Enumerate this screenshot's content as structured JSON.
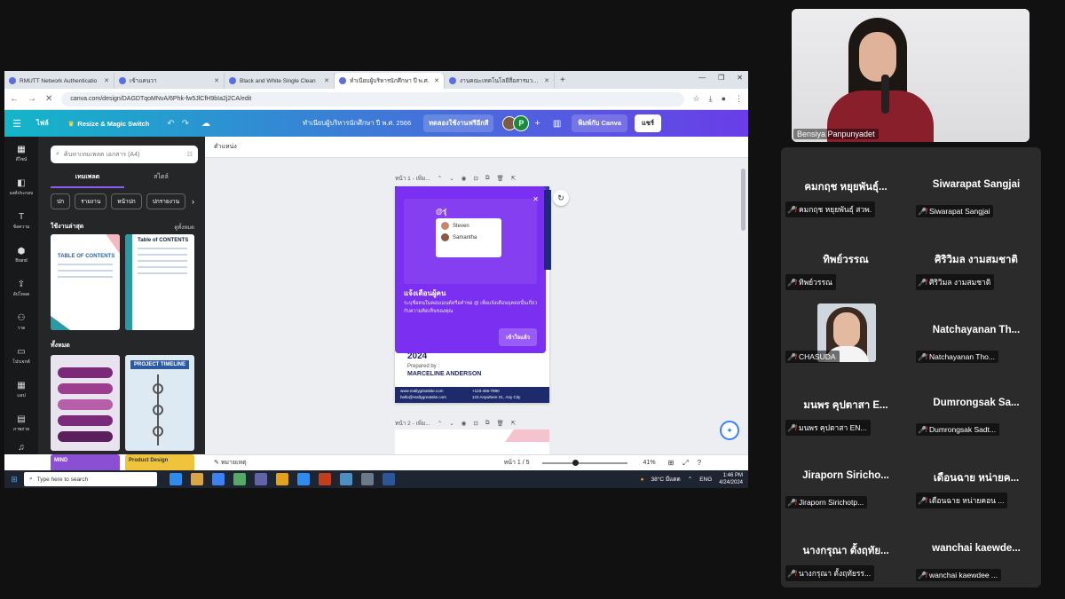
{
  "browser": {
    "tabs": [
      {
        "title": "RMUTT Network Authenticatio"
      },
      {
        "title": "เข้าแคนวา"
      },
      {
        "title": "Black and White Single Clean"
      },
      {
        "title": "ทำเนียบผู้บริหารนักศึกษา ปี พ.ศ."
      },
      {
        "title": "งานคณะเทคโนโลยีสื่อสารมวลชน - ..."
      }
    ],
    "url": "canva.com/design/DAGDTqoMNvA/6Phk-fw5JlCfH9bIa2j2CA/edit"
  },
  "canva": {
    "file_label": "ไฟล์",
    "resize_label": "Resize & Magic Switch",
    "doc_title": "ทำเนียบผู้บริหารนักศึกษา ปี พ.ศ. 2566",
    "trial_label": "ทดลองใช้งานฟรีอีกสี",
    "avatar_letter": "P",
    "print_label": "พิมพ์กับ Canva",
    "share_label": "แชร์",
    "rail": [
      {
        "icon": "▦",
        "label": "ดีไซน์"
      },
      {
        "icon": "◧",
        "label": "องค์ประกอบ"
      },
      {
        "icon": "T",
        "label": "ข้อความ"
      },
      {
        "icon": "⬢",
        "label": "Brand"
      },
      {
        "icon": "⇪",
        "label": "อัปโหลด"
      },
      {
        "icon": "⚇",
        "label": "วาด"
      },
      {
        "icon": "▭",
        "label": "โปรเจกต์"
      },
      {
        "icon": "▦",
        "label": "แอป"
      },
      {
        "icon": "▤",
        "label": "ภาพถ่าย"
      },
      {
        "icon": "♫",
        "label": "เสียง"
      }
    ],
    "panel": {
      "search_placeholder": "ค้นหาเทมเพลต เอกสาร (A4)",
      "tab_templates": "เทมเพลต",
      "tab_styles": "สไตล์",
      "chips": [
        "ปก",
        "รายงาน",
        "หน้าปก",
        "ปกรายงาน"
      ],
      "recent_heading": "ใช้งานล่าสุด",
      "see_all": "ดูทั้งหมด",
      "all_heading": "ทั้งหมด",
      "thumb1_title": "TABLE OF CONTENTS",
      "thumb2_title": "Table of CONTENTS",
      "thumb4_title": "PROJECT TIMELINE",
      "thumb5_title": "MIND",
      "thumb6_title": "Product Design"
    },
    "position_label": "ตำแหน่ง",
    "page1_label": "หน้า 1 - เพิ่ม...",
    "page2_label": "หน้า 2 - เพิ่ม...",
    "page_content": {
      "year": "2024",
      "prepared_by": "Prepared by :",
      "name": "MARCELINE ANDERSON",
      "site1": "www.reallygreatsite.com",
      "site2": "hello@reallygreatsite.com",
      "phone": "+123-456-7890",
      "address": "123 Anywhere St., Any City"
    },
    "popup": {
      "mention": "@รุ่",
      "name1": "Steven",
      "name2": "Samantha",
      "title": "แจ้งเตือนผู้คน",
      "desc": "ระบุชื่อคนในคอมเมนต์หรือคำขอ @ เพื่อแจ้งเตือนบุคคลนั้นเกี่ยวกับความคิดเห็นของคุณ",
      "button": "เข้าใจแล้ว"
    },
    "notes_label": "หมายเหตุ",
    "pages_label": "หน้า 1 / 5",
    "zoom_label": "41%",
    "zoom_level_percent": 41
  },
  "taskbar": {
    "search_placeholder": "Type here to search",
    "weather": "38°C มีแดด",
    "lang": "ENG",
    "time": "1:46 PM",
    "date": "4/24/2024"
  },
  "presenter": {
    "name": "Bensiya Panpunyadet"
  },
  "participants": [
    {
      "big": "คมกฤช หยุยพันธุ์...",
      "tag": "คมกฤช หยุยพันธุ์ สวพ."
    },
    {
      "big": "Siwarapat Sangjai",
      "tag": "Siwarapat Sangjai"
    },
    {
      "big": "ทิพย์วรรณ",
      "tag": "ทิพย์วรรณ"
    },
    {
      "big": "ศิริวิมล งามสมชาติ",
      "tag": "ศิริวิมล งามสมชาติ"
    },
    {
      "big": "",
      "tag": "CHASUDA",
      "photo": true
    },
    {
      "big": "Natchayanan Th...",
      "tag": "Natchayanan Tho..."
    },
    {
      "big": "มนพร คุปตาสา E...",
      "tag": "มนพร คุปตาสา EN..."
    },
    {
      "big": "Dumrongsak Sa...",
      "tag": "Dumrongsak Sadt..."
    },
    {
      "big": "Jiraporn Siricho...",
      "tag": "Jiraporn Sirichotp..."
    },
    {
      "big": "เดือนฉาย หน่ายค...",
      "tag": "เดือนฉาย หน่ายคอน ..."
    },
    {
      "big": "นางกรุณา ตั้งฤทัย...",
      "tag": "นางกรุณา ตั้งฤทัยรร..."
    },
    {
      "big": "wanchai kaewde...",
      "tag": "wanchai kaewdee ..."
    }
  ]
}
